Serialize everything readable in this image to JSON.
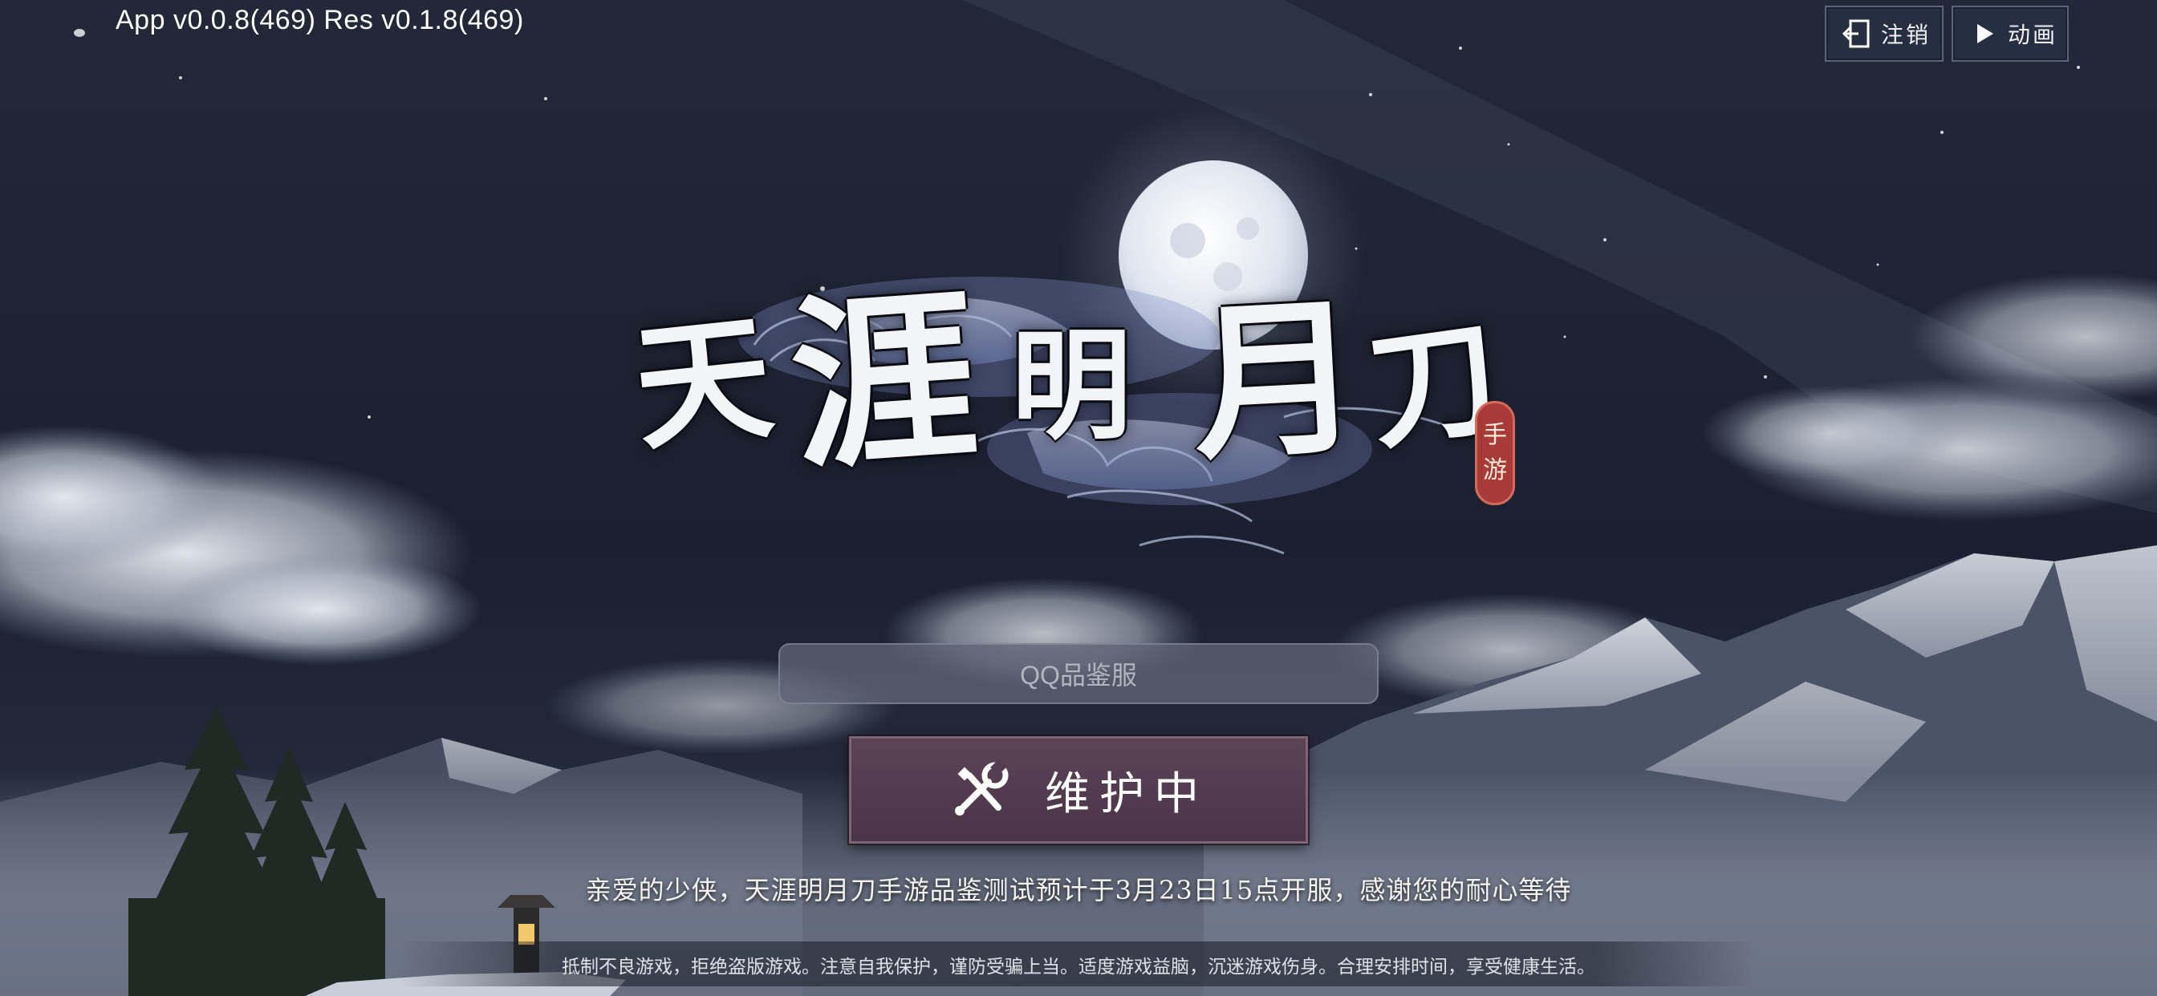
{
  "version_text": "App v0.0.8(469) Res v0.1.8(469)",
  "top_buttons": {
    "logout_label": "注销",
    "animation_label": "动画"
  },
  "logo": {
    "title_chars": [
      "天",
      "涯",
      "明",
      "月",
      "刀"
    ],
    "seal_chars": [
      "手",
      "游"
    ]
  },
  "server_field": {
    "value": "QQ品鉴服"
  },
  "main_button": {
    "label": "维护中",
    "icon": "tools-icon"
  },
  "notice_text": "亲爱的少侠，天涯明月刀手游品鉴测试预计于3月23日15点开服，感谢您的耐心等待",
  "health_advisory": "抵制不良游戏，拒绝盗版游戏。注意自我保护，谨防受骗上当。适度游戏益脑，沉迷游戏伤身。合理安排时间，享受健康生活。",
  "colors": {
    "sky": "#1c2130",
    "button_primary": "#553d51",
    "seal": "#a83a38"
  }
}
